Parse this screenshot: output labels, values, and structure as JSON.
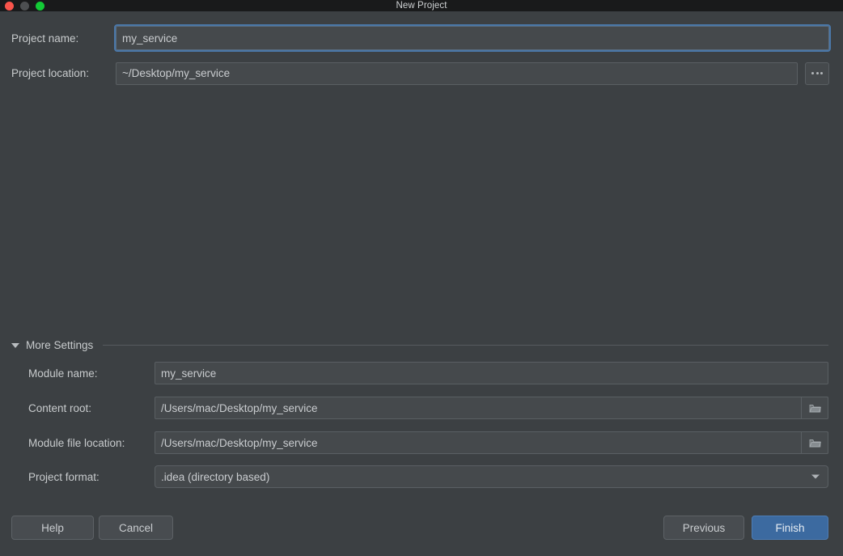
{
  "window": {
    "title": "New Project",
    "traffic_lights": [
      {
        "name": "close",
        "color": "#f9544b"
      },
      {
        "name": "minimize",
        "color": "#4d4f51"
      },
      {
        "name": "maximize",
        "color": "#13ca36"
      }
    ]
  },
  "form": {
    "project_name": {
      "label": "Project name:",
      "value": "my_service",
      "focused": true
    },
    "project_location": {
      "label": "Project location:",
      "value": "~/Desktop/my_service",
      "browse_label": "…"
    }
  },
  "more_settings": {
    "label": "More Settings",
    "expanded": true,
    "fields": {
      "module_name": {
        "label": "Module name:",
        "value": "my_service"
      },
      "content_root": {
        "label": "Content root:",
        "value": "/Users/mac/Desktop/my_service",
        "icon": "folder-icon"
      },
      "module_file_location": {
        "label": "Module file location:",
        "value": "/Users/mac/Desktop/my_service",
        "icon": "folder-icon"
      },
      "project_format": {
        "label": "Project format:",
        "value": ".idea (directory based)",
        "icon": "chevron-down-icon"
      }
    }
  },
  "buttons": {
    "help": "Help",
    "cancel": "Cancel",
    "previous": "Previous",
    "finish": "Finish"
  },
  "colors": {
    "window_background": "#3c4043",
    "titlebar": "#191a1b",
    "field_background": "#45494c",
    "accent": "#3c6aa0",
    "focus_ring": "#4a77a8",
    "text": "#c8cbcd"
  }
}
